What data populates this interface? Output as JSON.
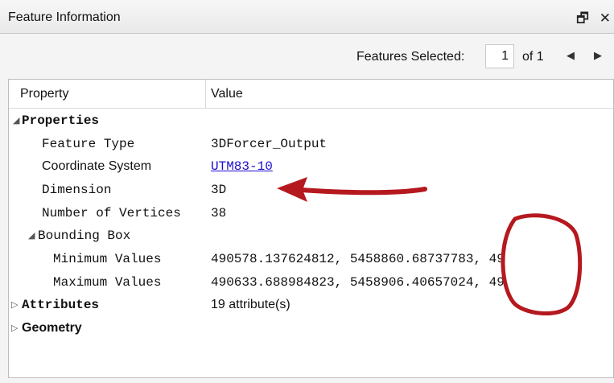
{
  "window": {
    "title": "Feature Information",
    "restore_glyph": "🗗",
    "close_glyph": "✕"
  },
  "toolbar": {
    "features_selected_label": "Features Selected:",
    "current_index": "1",
    "of_total": "of 1",
    "prev_glyph": "◀",
    "next_glyph": "▶"
  },
  "table": {
    "columns": [
      "Property",
      "Value"
    ],
    "rows": [
      {
        "property": "Properties",
        "value": "",
        "expanded": true
      },
      {
        "property": "Feature Type",
        "value": "3DForcer_Output"
      },
      {
        "property": "Coordinate System",
        "value": "UTM83-10"
      },
      {
        "property": "Dimension",
        "value": "3D"
      },
      {
        "property": "Number of Vertices",
        "value": "38"
      },
      {
        "property": "Bounding Box",
        "value": "",
        "expanded": true
      },
      {
        "property": "Minimum Values",
        "value": "490578.137624812, 5458860.68737783, 49"
      },
      {
        "property": "Maximum Values",
        "value": "490633.688984823, 5458906.40657024, 49"
      },
      {
        "property": "Attributes",
        "value": "19 attribute(s)",
        "expanded": false
      },
      {
        "property": "Geometry",
        "value": "",
        "expanded": false
      }
    ]
  },
  "colors": {
    "annotation_red": "#b5191f",
    "link": "#1a0dcc"
  },
  "icons": {
    "expanded": "◢",
    "collapsed": "▷"
  }
}
